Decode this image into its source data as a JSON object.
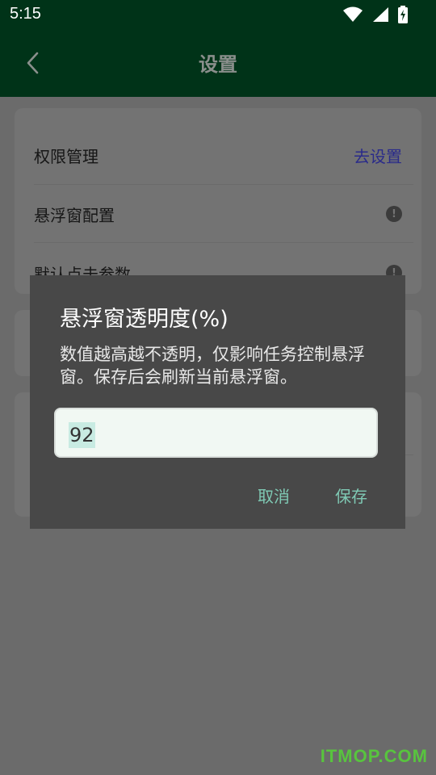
{
  "status_bar": {
    "time": "5:15",
    "icons": [
      "wifi-icon",
      "signal-icon",
      "battery-charging-icon"
    ]
  },
  "app_bar": {
    "title": "设置",
    "back_icon": "chevron-left-icon"
  },
  "settings": {
    "items": [
      {
        "label": "权限管理",
        "action": "去设置"
      },
      {
        "label": "悬浮窗配置",
        "info_glyph": "!"
      },
      {
        "label": "默认点击参数",
        "info_glyph": "!"
      }
    ]
  },
  "dialog": {
    "title": "悬浮窗透明度(%)",
    "message": "数值越高越不透明，仅影响任务控制悬浮窗。保存后会刷新当前悬浮窗。",
    "input_value": "92",
    "cancel_label": "取消",
    "save_label": "保存"
  },
  "watermark": "ITMOP.COM",
  "colors": {
    "app_bar": "#003318",
    "dialog_bg": "#484848",
    "dialog_button": "#7fc9b4",
    "link_action": "#2a2b8a",
    "input_selection": "#c8ebe2",
    "watermark": "#58c43e"
  }
}
